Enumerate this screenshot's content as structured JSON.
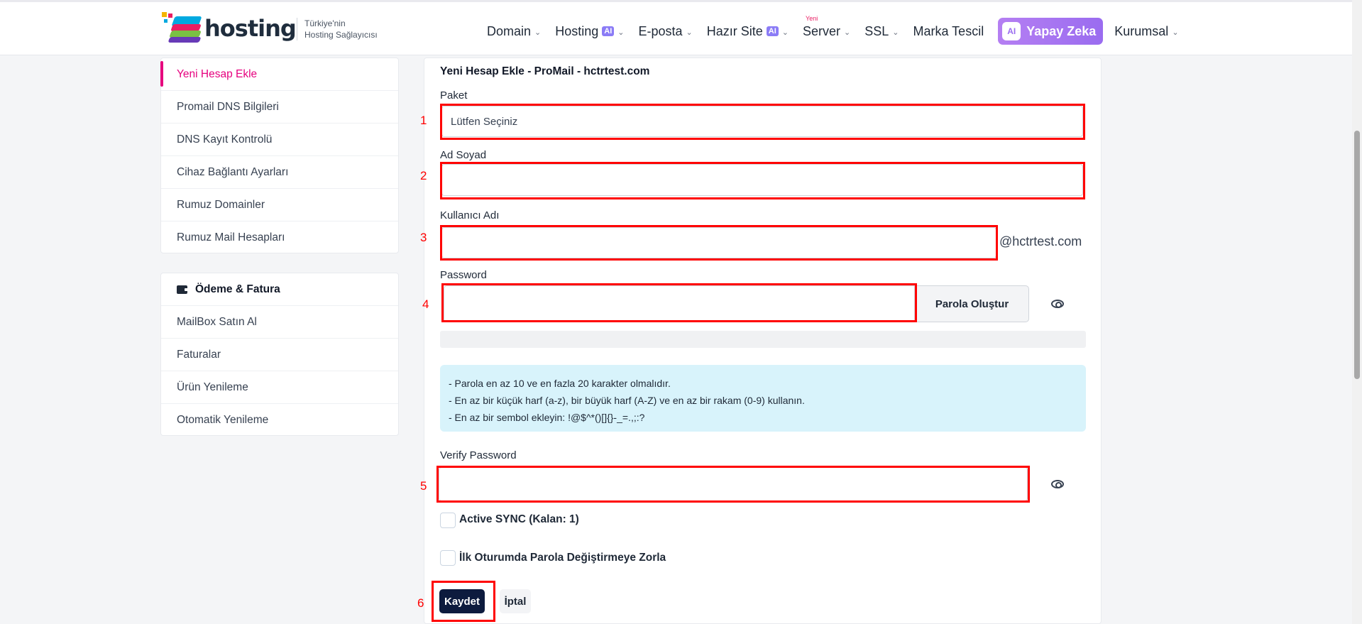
{
  "header": {
    "logo_text": "hosting",
    "tagline_line1": "Türkiye'nin",
    "tagline_line2": "Hosting Sağlayıcısı",
    "nav": [
      {
        "label": "Domain"
      },
      {
        "label": "Hosting",
        "badge": "AI"
      },
      {
        "label": "E-posta"
      },
      {
        "label": "Hazır Site",
        "badge": "AI"
      },
      {
        "label": "Server",
        "tag": "Yeni"
      },
      {
        "label": "SSL"
      },
      {
        "label": "Marka Tescil"
      }
    ],
    "ai_button": "Yapay Zeka",
    "ai_icon_text": "AI",
    "kurumsal": "Kurumsal"
  },
  "sidebar": {
    "items": [
      {
        "label": "Yeni Hesap Ekle"
      },
      {
        "label": "Promail DNS Bilgileri"
      },
      {
        "label": "DNS Kayıt Kontrolü"
      },
      {
        "label": "Cihaz Bağlantı Ayarları"
      },
      {
        "label": "Rumuz Domainler"
      },
      {
        "label": "Rumuz Mail Hesapları"
      }
    ],
    "billing_title": "Ödeme & Fatura",
    "billing_items": [
      {
        "label": "MailBox Satın Al"
      },
      {
        "label": "Faturalar"
      },
      {
        "label": "Ürün Yenileme"
      },
      {
        "label": "Otomatik Yenileme"
      }
    ]
  },
  "form": {
    "title": "Yeni Hesap Ekle - ProMail - hctrtest.com",
    "paket_label": "Paket",
    "paket_value": "Lütfen Seçiniz",
    "name_label": "Ad Soyad",
    "name_value": "",
    "username_label": "Kullanıcı Adı",
    "username_value": "",
    "username_suffix": "@hctrtest.com",
    "password_label": "Password",
    "password_value": "",
    "generate_button": "Parola Oluştur",
    "rules": [
      "- Parola en az 10 ve en fazla 20 karakter olmalıdır.",
      "- En az bir küçük harf (a-z), bir büyük harf (A-Z) ve en az bir rakam (0-9) kullanın.",
      "- En az bir sembol ekleyin: !@$^*()[]{}-_=.,;:?"
    ],
    "verify_label": "Verify Password",
    "verify_value": "",
    "active_sync_label": "Active SYNC (Kalan: 1)",
    "force_change_label": "İlk Oturumda Parola Değiştirmeye Zorla",
    "save_button": "Kaydet",
    "cancel_button": "İptal"
  },
  "annotations": [
    "1",
    "2",
    "3",
    "4",
    "5",
    "6"
  ]
}
